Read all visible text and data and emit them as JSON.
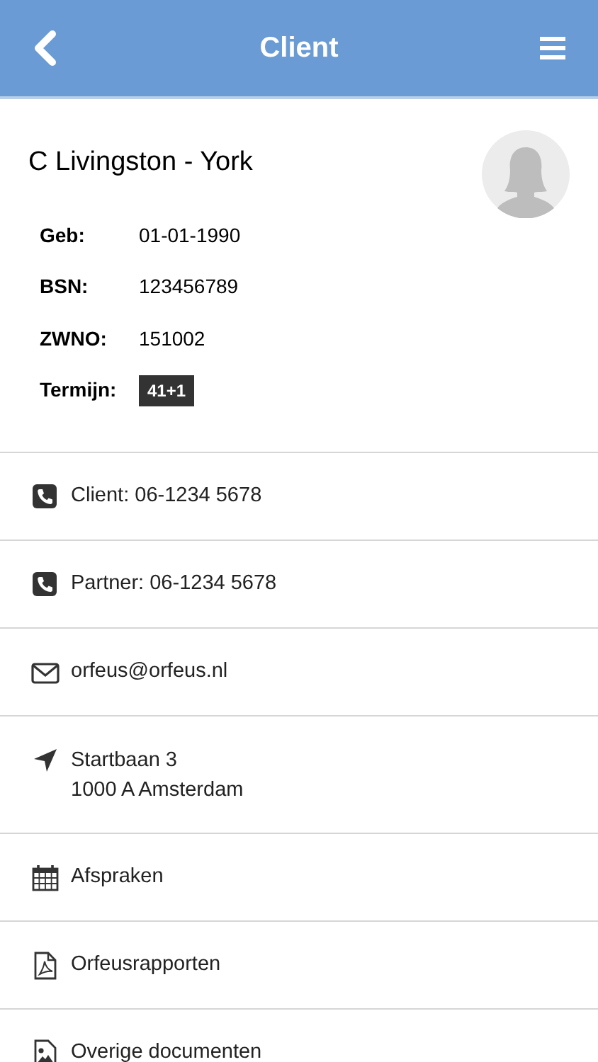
{
  "header": {
    "title": "Client"
  },
  "client": {
    "name": "C Livingston - York",
    "fields": [
      {
        "label": "Geb:",
        "value": "01-01-1990",
        "kind": "text"
      },
      {
        "label": "BSN:",
        "value": "123456789",
        "kind": "text"
      },
      {
        "label": "ZWNO:",
        "value": "151002",
        "kind": "text"
      },
      {
        "label": "Termijn:",
        "value": "41+1",
        "kind": "badge"
      }
    ]
  },
  "items": [
    {
      "kind": "phone",
      "lines": [
        "Client: 06-1234 5678"
      ]
    },
    {
      "kind": "phone",
      "lines": [
        "Partner: 06-1234 5678"
      ]
    },
    {
      "kind": "mail",
      "lines": [
        "orfeus@orfeus.nl"
      ]
    },
    {
      "kind": "location",
      "lines": [
        "Startbaan 3",
        "1000 A Amsterdam"
      ]
    },
    {
      "kind": "calendar",
      "lines": [
        "Afspraken"
      ]
    },
    {
      "kind": "pdf",
      "lines": [
        "Orfeusrapporten"
      ]
    },
    {
      "kind": "image",
      "lines": [
        "Overige documenten"
      ]
    }
  ]
}
